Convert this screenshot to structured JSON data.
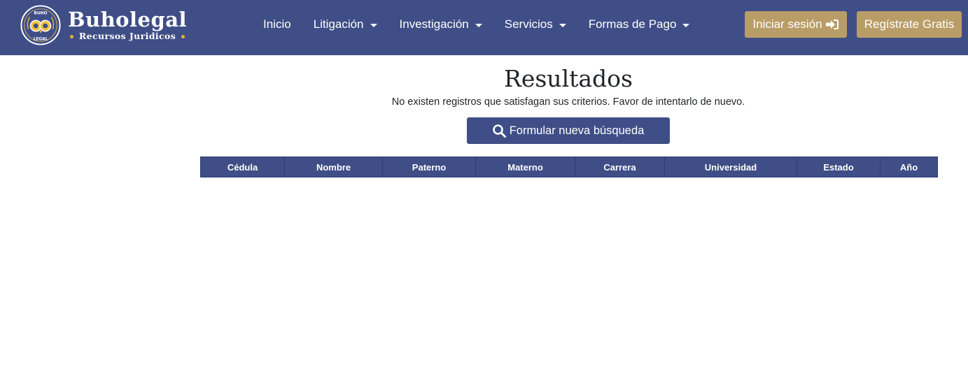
{
  "brand": {
    "name": "Buholegal",
    "subtitle": "Recursos Juridicos",
    "logo_text_top": "BUHO",
    "logo_text_bottom": "LEGAL"
  },
  "nav": {
    "items": [
      {
        "label": "Inicio",
        "dropdown": false
      },
      {
        "label": "Litigación",
        "dropdown": true
      },
      {
        "label": "Investigación",
        "dropdown": true
      },
      {
        "label": "Servicios",
        "dropdown": true
      },
      {
        "label": "Formas de Pago",
        "dropdown": true
      }
    ],
    "login_label": "Iniciar sesión",
    "register_label": "Regístrate Gratis"
  },
  "main": {
    "title": "Resultados",
    "message": "No existen registros que satisfagan sus criterios. Favor de intentarlo de nuevo.",
    "search_button_label": "Formular nueva búsqueda"
  },
  "table": {
    "columns": [
      "Cédula",
      "Nombre",
      "Paterno",
      "Materno",
      "Carrera",
      "Universidad",
      "Estado",
      "Año"
    ],
    "rows": []
  },
  "colors": {
    "navbar": "#3f4e86",
    "gold_button": "#b99d67",
    "brand_dot": "#e8b52a",
    "primary_button": "#3f4e86"
  },
  "icons": {
    "login": "sign-in-icon",
    "search": "search-icon",
    "caret": "caret-down-icon"
  }
}
